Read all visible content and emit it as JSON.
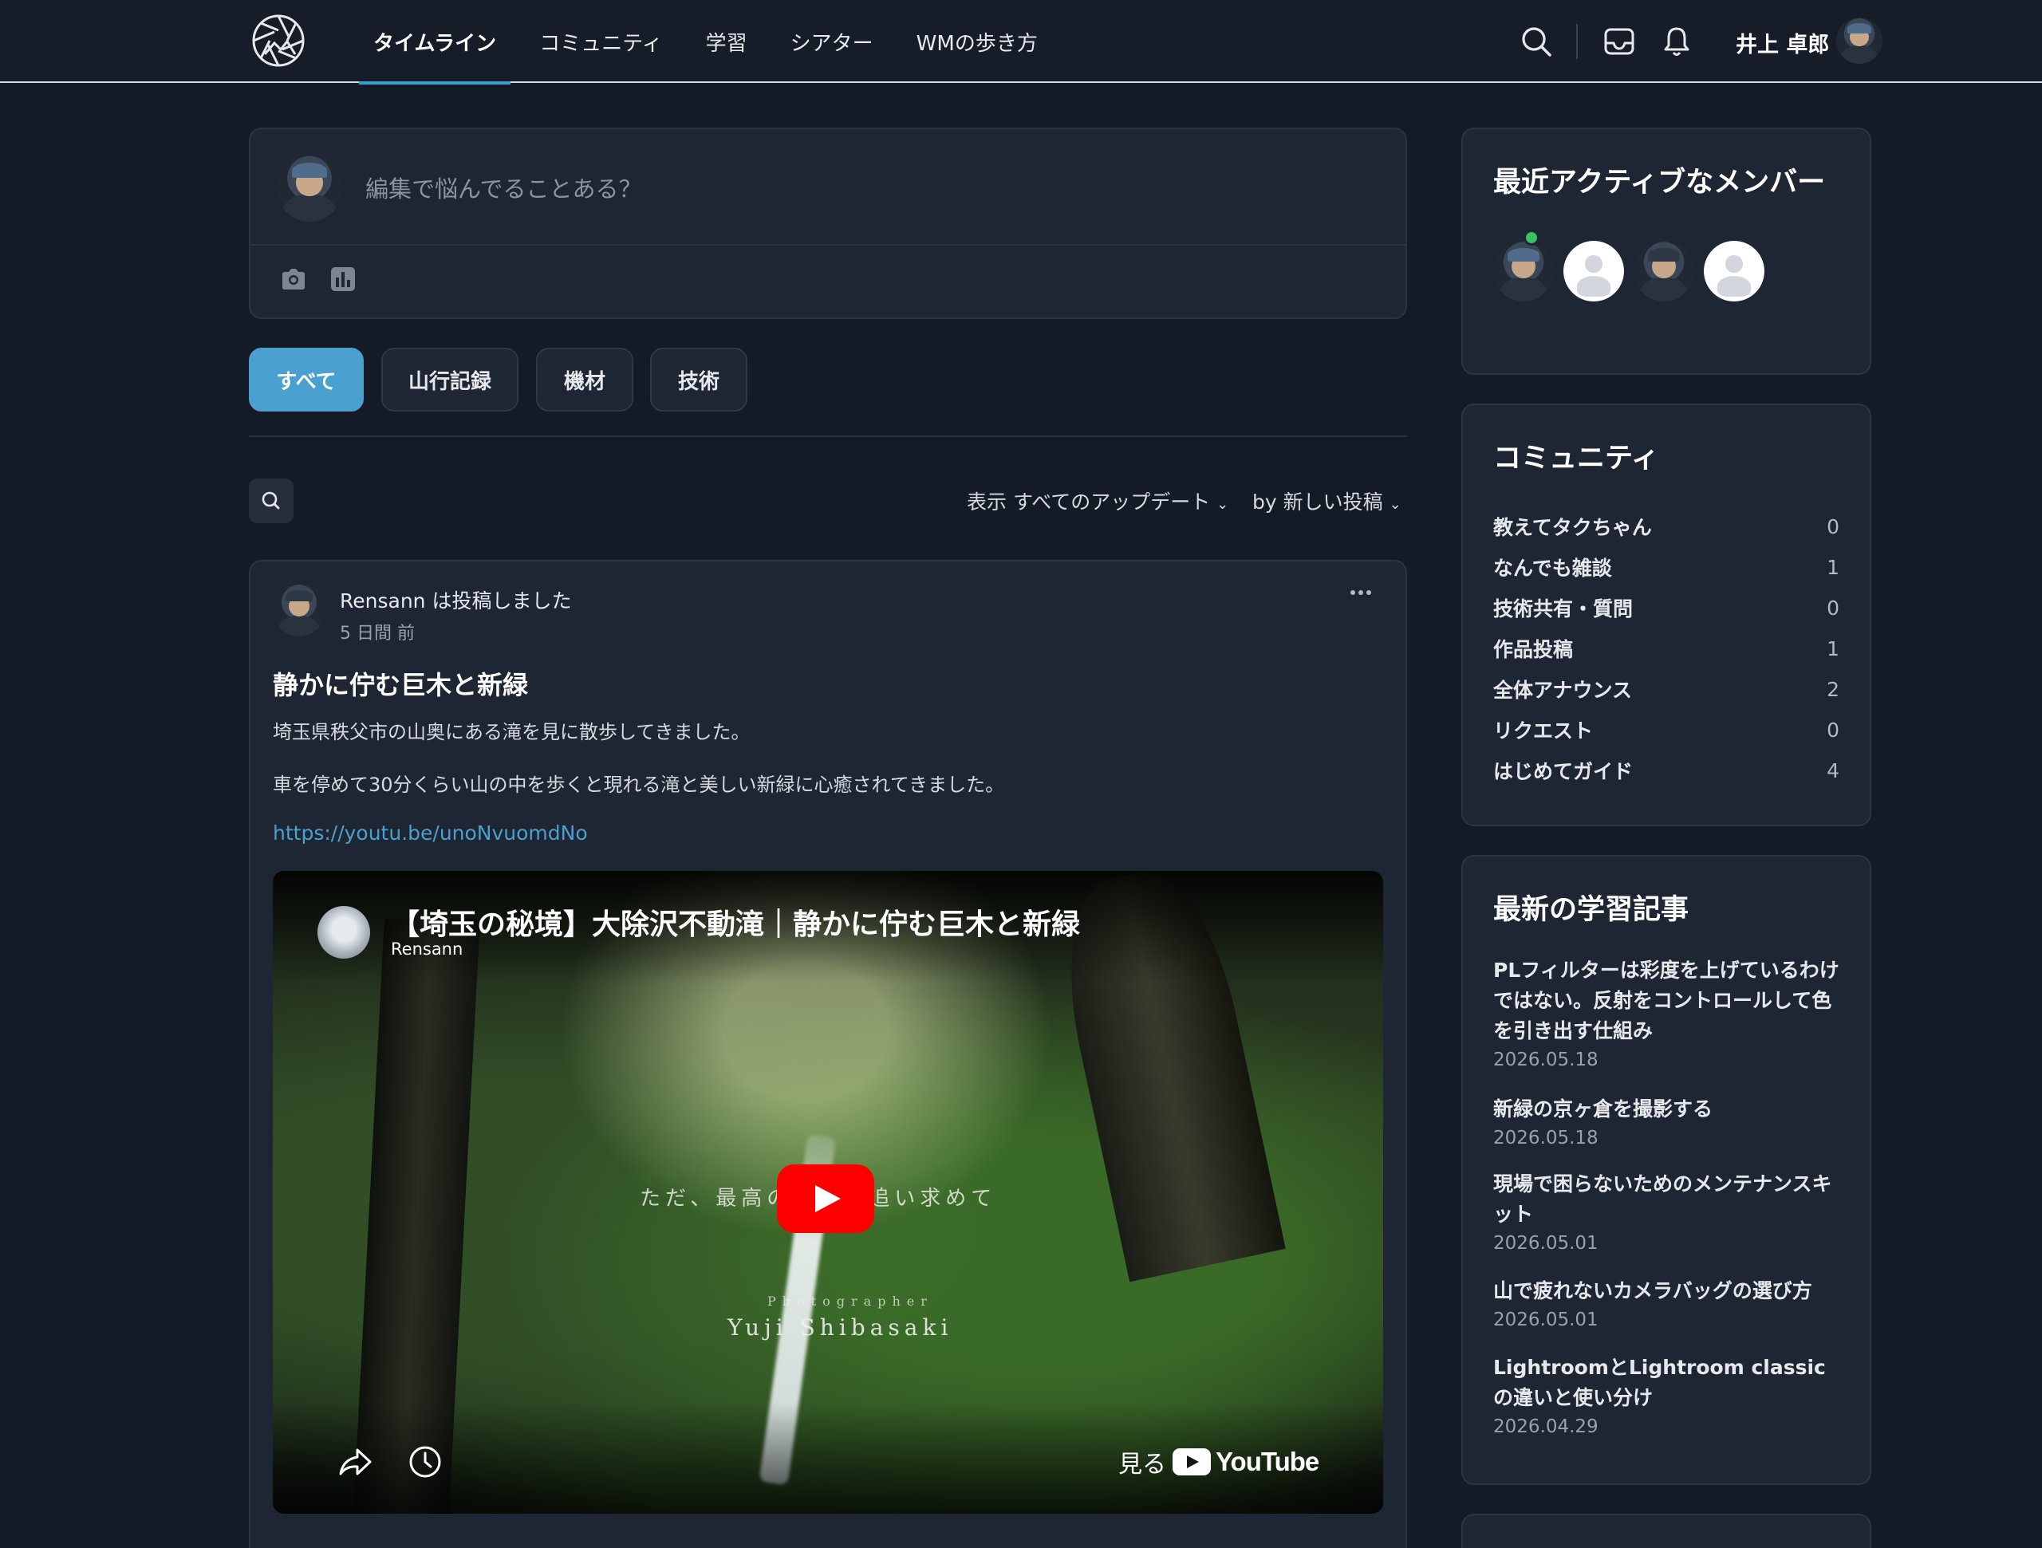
{
  "nav": {
    "items": [
      {
        "label": "タイムライン",
        "active": true
      },
      {
        "label": "コミュニティ",
        "active": false
      },
      {
        "label": "学習",
        "active": false
      },
      {
        "label": "シアター",
        "active": false
      },
      {
        "label": "WMの歩き方",
        "active": false
      }
    ],
    "user_name": "井上 卓郎",
    "icons": [
      "search-icon",
      "inbox-icon",
      "bell-icon"
    ]
  },
  "composer": {
    "placeholder": "編集で悩んでることある？",
    "icons": [
      "camera-icon",
      "poll-icon"
    ]
  },
  "filters": [
    {
      "label": "すべて",
      "active": true
    },
    {
      "label": "山行記録",
      "active": false
    },
    {
      "label": "機材",
      "active": false
    },
    {
      "label": "技術",
      "active": false
    }
  ],
  "sort": {
    "show_label": "表示 すべてのアップデート",
    "order_label": "by 新しい投稿"
  },
  "post": {
    "author_line": "Rensann は投稿しました",
    "time": "5 日間 前",
    "title": "静かに佇む巨木と新緑",
    "paragraph1": "埼玉県秩父市の山奥にある滝を見に散歩してきました。",
    "paragraph2": "車を停めて30分くらい山の中を歩くと現れる滝と美しい新緑に心癒されてきました。",
    "link": "https://youtu.be/unoNvuomdNo",
    "video": {
      "title": "【埼玉の秘境】大除沢不動滝｜静かに佇む巨木と新緑",
      "channel": "Rensann",
      "overlay_text": "ただ、最高の一瞬を追い求めて",
      "overlay_role": "Photographer",
      "overlay_name": "Yuji Shibasaki",
      "watch_label": "見る",
      "brand": "YouTube"
    }
  },
  "sidebar": {
    "members": {
      "title": "最近アクティブなメンバー",
      "online_color": "#3ac162"
    },
    "community": {
      "title": "コミュニティ",
      "items": [
        {
          "name": "教えてタクちゃん",
          "count": "0"
        },
        {
          "name": "なんでも雑談",
          "count": "1"
        },
        {
          "name": "技術共有・質問",
          "count": "0"
        },
        {
          "name": "作品投稿",
          "count": "1"
        },
        {
          "name": "全体アナウンス",
          "count": "2"
        },
        {
          "name": "リクエスト",
          "count": "0"
        },
        {
          "name": "はじめてガイド",
          "count": "4"
        }
      ]
    },
    "learning": {
      "title": "最新の学習記事",
      "articles": [
        {
          "title": "PLフィルターは彩度を上げているわけではない。反射をコントロールして色を引き出す仕組み",
          "date": "2026.05.18"
        },
        {
          "title": "新緑の京ヶ倉を撮影する",
          "date": "2026.05.18"
        },
        {
          "title": "現場で困らないためのメンテナンスキット",
          "date": "2026.05.01"
        },
        {
          "title": "山で疲れないカメラバッグの選び方",
          "date": "2026.05.01"
        },
        {
          "title": "LightroomとLightroom classicの違いと使い分け",
          "date": "2026.04.29"
        }
      ]
    }
  },
  "colors": {
    "accent": "#4aa0cf",
    "background": "#151b26",
    "card": "#1e2533",
    "play_red": "#ff0000"
  }
}
